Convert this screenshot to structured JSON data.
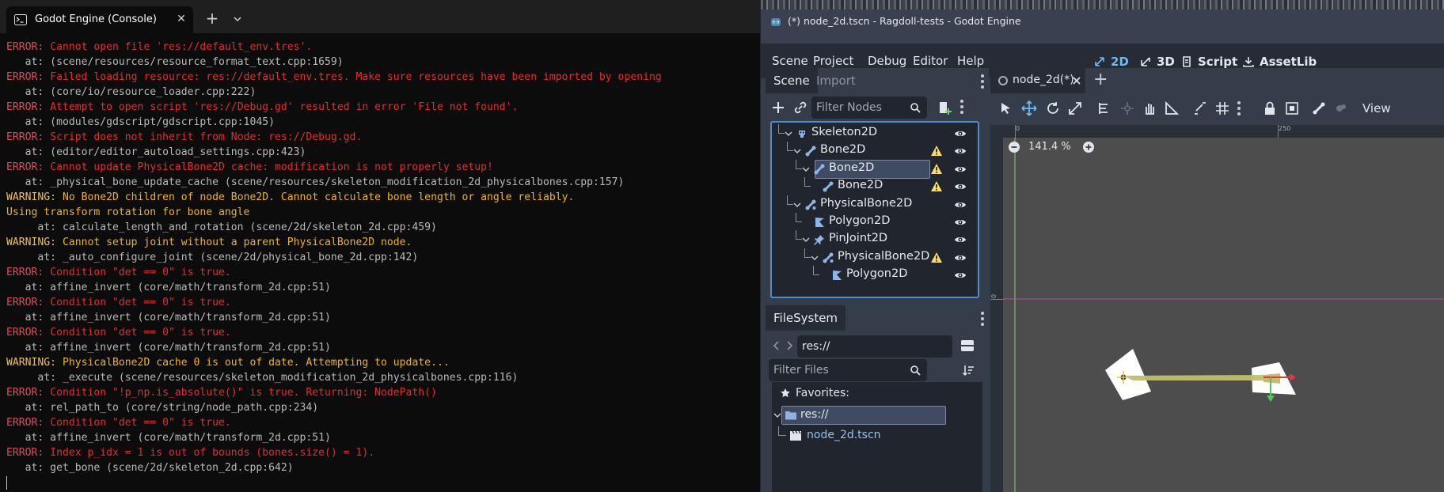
{
  "terminal": {
    "tab_title": "Godot Engine (Console)",
    "new_tab_label": "+",
    "close_label": "✕",
    "lines": [
      {
        "kind": "err",
        "level": "ERROR:",
        "text": " Cannot open file 'res://default_env.tres'."
      },
      {
        "kind": "sub",
        "text": "   at: (scene/resources/resource_format_text.cpp:1659)"
      },
      {
        "kind": "err",
        "level": "ERROR:",
        "text": " Failed loading resource: res://default_env.tres. Make sure resources have been imported by opening"
      },
      {
        "kind": "sub",
        "text": "   at: (core/io/resource_loader.cpp:222)"
      },
      {
        "kind": "err",
        "level": "ERROR:",
        "text": " Attempt to open script 'res://Debug.gd' resulted in error 'File not found'."
      },
      {
        "kind": "sub",
        "text": "   at: (modules/gdscript/gdscript.cpp:1045)"
      },
      {
        "kind": "err",
        "level": "ERROR:",
        "text": " Script does not inherit from Node: res://Debug.gd."
      },
      {
        "kind": "sub",
        "text": "   at: (editor/editor_autoload_settings.cpp:423)"
      },
      {
        "kind": "err",
        "level": "ERROR:",
        "text": " Cannot update PhysicalBone2D cache: modification is not properly setup!"
      },
      {
        "kind": "sub",
        "text": "   at: _physical_bone_update_cache (scene/resources/skeleton_modification_2d_physicalbones.cpp:157)"
      },
      {
        "kind": "warn",
        "level": "WARNING:",
        "text": " No Bone2D children of node Bone2D. Cannot calculate bone length or angle reliably."
      },
      {
        "kind": "warnplain",
        "text": "Using transform rotation for bone angle"
      },
      {
        "kind": "sub",
        "text": "     at: calculate_length_and_rotation (scene/2d/skeleton_2d.cpp:459)"
      },
      {
        "kind": "warn",
        "level": "WARNING:",
        "text": " Cannot setup joint without a parent PhysicalBone2D node."
      },
      {
        "kind": "sub",
        "text": "     at: _auto_configure_joint (scene/2d/physical_bone_2d.cpp:142)"
      },
      {
        "kind": "err",
        "level": "ERROR:",
        "text": " Condition \"det == 0\" is true."
      },
      {
        "kind": "sub",
        "text": "   at: affine_invert (core/math/transform_2d.cpp:51)"
      },
      {
        "kind": "err",
        "level": "ERROR:",
        "text": " Condition \"det == 0\" is true."
      },
      {
        "kind": "sub",
        "text": "   at: affine_invert (core/math/transform_2d.cpp:51)"
      },
      {
        "kind": "err",
        "level": "ERROR:",
        "text": " Condition \"det == 0\" is true."
      },
      {
        "kind": "sub",
        "text": "   at: affine_invert (core/math/transform_2d.cpp:51)"
      },
      {
        "kind": "warn",
        "level": "WARNING:",
        "text": " PhysicalBone2D cache 0 is out of date. Attempting to update..."
      },
      {
        "kind": "sub",
        "text": "     at: _execute (scene/resources/skeleton_modification_2d_physicalbones.cpp:116)"
      },
      {
        "kind": "err",
        "level": "ERROR:",
        "text": " Condition \"!p_np.is_absolute()\" is true. Returning: NodePath()"
      },
      {
        "kind": "sub",
        "text": "   at: rel_path_to (core/string/node_path.cpp:234)"
      },
      {
        "kind": "err",
        "level": "ERROR:",
        "text": " Condition \"det == 0\" is true."
      },
      {
        "kind": "sub",
        "text": "   at: affine_invert (core/math/transform_2d.cpp:51)"
      },
      {
        "kind": "err",
        "level": "ERROR:",
        "text": " Index p_idx = 1 is out of bounds (bones.size() = 1)."
      },
      {
        "kind": "sub",
        "text": "   at: get_bone (scene/2d/skeleton_2d.cpp:642)"
      }
    ]
  },
  "godot": {
    "window_title": "(*) node_2d.tscn - Ragdoll-tests - Godot Engine",
    "menu": {
      "scene": "Scene",
      "project": "Project",
      "debug": "Debug",
      "editor": "Editor",
      "help": "Help"
    },
    "modes": {
      "two_d": "2D",
      "three_d": "3D",
      "script": "Script",
      "assetlib": "AssetLib"
    },
    "scene_dock": {
      "tab_scene": "Scene",
      "tab_import": "Import",
      "filter_placeholder": "Filter Nodes",
      "nodes": [
        {
          "name": "Skeleton2D",
          "depth": 0,
          "icon": "skeleton-icon",
          "warn": false
        },
        {
          "name": "Bone2D",
          "depth": 1,
          "icon": "bone-icon",
          "warn": true
        },
        {
          "name": "Bone2D",
          "depth": 2,
          "icon": "bone-icon",
          "warn": true,
          "selected": true
        },
        {
          "name": "Bone2D",
          "depth": 3,
          "icon": "bone-icon",
          "warn": true
        },
        {
          "name": "PhysicalBone2D",
          "depth": 1,
          "icon": "physical-bone-icon",
          "warn": false
        },
        {
          "name": "Polygon2D",
          "depth": 2,
          "icon": "polygon-icon",
          "warn": false
        },
        {
          "name": "PinJoint2D",
          "depth": 2,
          "icon": "pin-joint-icon",
          "warn": false
        },
        {
          "name": "PhysicalBone2D",
          "depth": 3,
          "icon": "physical-bone-icon",
          "warn": true
        },
        {
          "name": "Polygon2D",
          "depth": 4,
          "icon": "polygon-icon",
          "warn": false
        }
      ]
    },
    "filesystem": {
      "tab": "FileSystem",
      "path": "res://",
      "filter_placeholder": "Filter Files",
      "favorites_label": "Favorites:",
      "root": "res://",
      "file": "node_2d.tscn"
    },
    "viewport": {
      "tab_label": "node_2d(*)",
      "add_tab": "+",
      "view_menu": "View",
      "zoom": "141.4 %",
      "ruler_marks": [
        "0",
        "250"
      ],
      "ruler_left_mark": "0"
    },
    "colors": {
      "accent": "#6dbaf5",
      "error": "#e62b2b",
      "warning": "#f0b31d"
    }
  }
}
